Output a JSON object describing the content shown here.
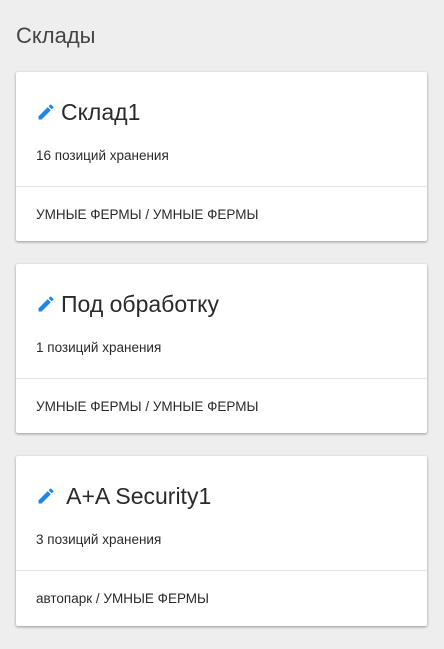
{
  "page": {
    "title": "Склады"
  },
  "colors": {
    "accent": "#1e88e5",
    "background": "#eeeeee",
    "card": "#ffffff"
  },
  "warehouses": [
    {
      "title": "Склад1",
      "count_text": "16 позиций хранения",
      "footer": "УМНЫЕ ФЕРМЫ / УМНЫЕ ФЕРМЫ",
      "icon": "pencil-icon"
    },
    {
      "title": "Под обработку",
      "count_text": "1 позиций хранения",
      "footer": "УМНЫЕ ФЕРМЫ / УМНЫЕ ФЕРМЫ",
      "icon": "pencil-icon"
    },
    {
      "title": " A+A Security1",
      "count_text": "3 позиций хранения",
      "footer": "автопарк / УМНЫЕ ФЕРМЫ",
      "icon": "pencil-icon"
    }
  ]
}
